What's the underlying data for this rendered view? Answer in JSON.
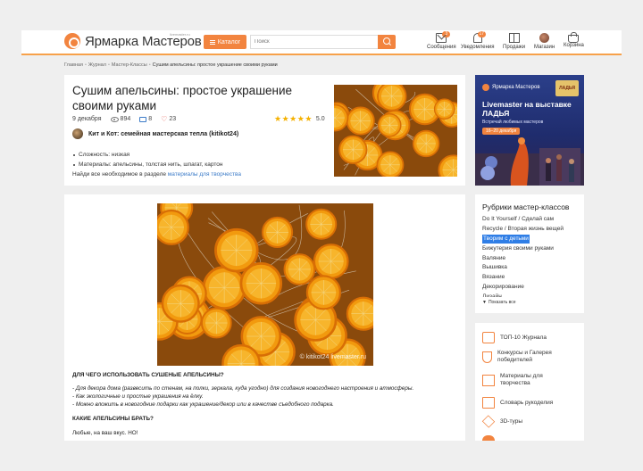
{
  "header": {
    "logo_text": "Ярмарка Мастеров",
    "logo_sub": "livemaster.ru",
    "catalog_label": "Каталог",
    "search_placeholder": "Поиск",
    "nav": [
      {
        "label": "Сообщения",
        "badge": "3"
      },
      {
        "label": "Уведомления",
        "badge": "17"
      },
      {
        "label": "Продажи"
      },
      {
        "label": "Магазин"
      },
      {
        "label": "Корзина"
      }
    ]
  },
  "breadcrumb": {
    "items": [
      "Главная",
      "Журнал",
      "Мастер-Классы"
    ],
    "current": "Сушим апельсины: простое украшение своими руками"
  },
  "article": {
    "title": "Сушим апельсины: простое украшение своими руками",
    "date": "9 декабря",
    "views": "894",
    "comments": "8",
    "likes": "23",
    "rating": "5.0",
    "author": "Кит и Кот: семейная мастерская тепла (kitikot24)",
    "details": [
      "Сложность: низкая",
      "Материалы: апельсины, толстая нить, шпагат, картон"
    ],
    "materials_prefix": "Найди все необходимое в разделе",
    "materials_link": "материалы для творчества"
  },
  "banner": {
    "logo": "Ярмарка Мастеров",
    "badge": "ЛАДЬЯ",
    "headline": "Livemaster на выставке ЛАДЬЯ",
    "sub": "Встречай любимых мастеров",
    "dates": "16–20 декабря"
  },
  "rubrics": {
    "title": "Рубрики мастер-классов",
    "items": [
      "Do It Yourself / Сделай сам",
      "Recycle / Вторая жизнь вещей",
      "Творим с детьми",
      "Бижутерия своими руками",
      "Валяние",
      "Вышивка",
      "Вязание",
      "Декорирование",
      "Дизайн"
    ],
    "show_all": "Показать все"
  },
  "sidebar_links": [
    {
      "label": "ТОП-10 Журнала",
      "icon": "thumbs-up-icon"
    },
    {
      "label": "Конкурсы и Галерея победителей",
      "icon": "trophy-icon"
    },
    {
      "label": "Материалы для творчества",
      "icon": "box-icon"
    },
    {
      "label": "Словарь рукоделия",
      "icon": "book-icon"
    },
    {
      "label": "3D-туры",
      "icon": "cube-icon"
    }
  ],
  "content": {
    "watermark": "© kitikot24 livemaster.ru",
    "heading1": "ДЛЯ ЧЕГО ИСПОЛЬЗОВАТЬ СУШЕНЫЕ АПЕЛЬСИНЫ?",
    "bullets": [
      "- Для декора дома (развесить по стенам, на полки, зеркала, куда угодно) для создания новогоднего настроения и атмосферы.",
      "- Как экологичные и простые украшения на ёлку.",
      "- Можно вложить в новогодние подарки как украшение/декор или в качестве съедобного подарка."
    ],
    "heading2": "КАКИЕ АПЕЛЬСИНЫ БРАТЬ?",
    "para": "Любые, на ваш вкус. НО!"
  },
  "colors": {
    "accent": "#f2843f",
    "link": "#3b7bc8",
    "highlight": "#2f7ee6"
  }
}
